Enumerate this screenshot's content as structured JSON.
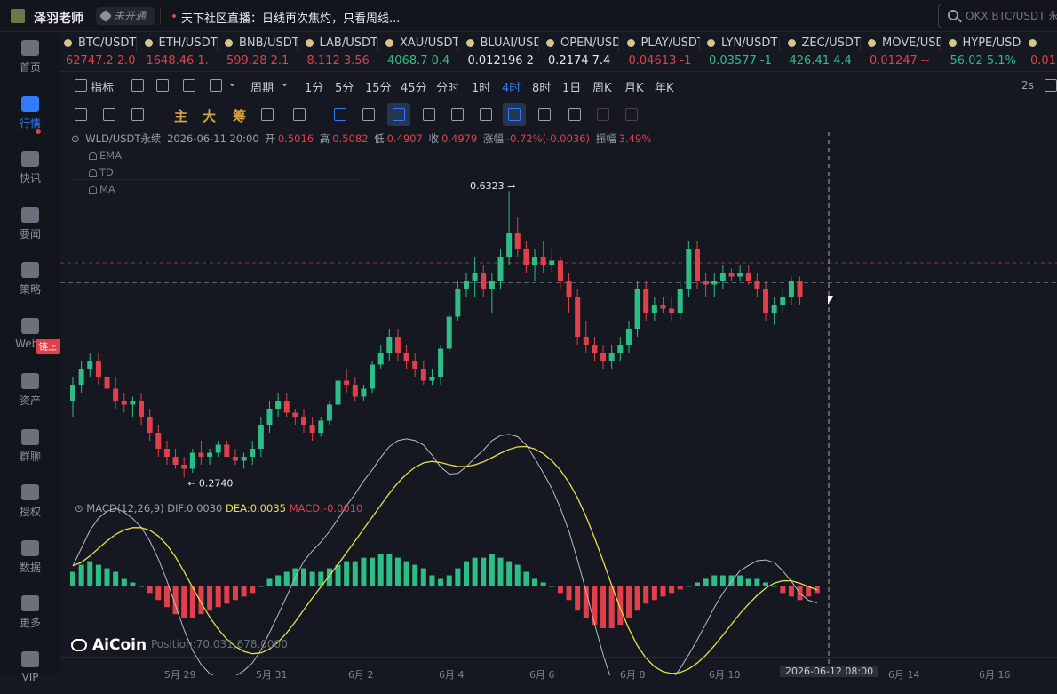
{
  "header": {
    "user_name": "泽羽老师",
    "status_badge": "未开通",
    "news": "天下社区直播：日线再次焦灼，只看周线...",
    "search_placeholder": "OKX BTC/USDT 永续"
  },
  "sidebar": {
    "items": [
      {
        "label": "首页",
        "icon": "home-icon"
      },
      {
        "label": "行情",
        "icon": "market-icon"
      },
      {
        "label": "快讯",
        "icon": "flash-news-icon"
      },
      {
        "label": "要闻",
        "icon": "news-icon"
      },
      {
        "label": "策略",
        "icon": "strategy-icon"
      },
      {
        "label": "Web3",
        "icon": "web3-icon"
      },
      {
        "label": "资产",
        "icon": "wallet-icon"
      },
      {
        "label": "群聊",
        "icon": "chat-icon"
      },
      {
        "label": "授权",
        "icon": "key-icon"
      },
      {
        "label": "数据",
        "icon": "data-icon"
      },
      {
        "label": "更多",
        "icon": "more-icon"
      },
      {
        "label": "VIP",
        "icon": "vip-icon"
      }
    ],
    "badge": "链上"
  },
  "ticker": [
    {
      "name": "BTC/USDT",
      "price": "62747.2",
      "change": "2.0",
      "dir": "dn"
    },
    {
      "name": "ETH/USDT",
      "price": "1648.46",
      "change": "1.",
      "dir": "dn"
    },
    {
      "name": "BNB/USDT",
      "price": "599.28",
      "change": "2.1",
      "dir": "dn"
    },
    {
      "name": "LAB/USDT",
      "price": "8.112",
      "change": "3.56",
      "dir": "dn"
    },
    {
      "name": "XAU/USDT",
      "price": "4068.7",
      "change": "0.4",
      "dir": "up"
    },
    {
      "name": "BLUAI/USDT",
      "price": "0.012196",
      "change": "2",
      "dir": "wh"
    },
    {
      "name": "OPEN/USDT",
      "price": "0.2174",
      "change": "7.4",
      "dir": "wh"
    },
    {
      "name": "PLAY/USDT",
      "price": "0.04613",
      "change": "-1",
      "dir": "dn"
    },
    {
      "name": "LYN/USDT",
      "price": "0.03577",
      "change": "-1",
      "dir": "up"
    },
    {
      "name": "ZEC/USDT",
      "price": "426.41",
      "change": "4.4",
      "dir": "up"
    },
    {
      "name": "MOVE/USDT",
      "price": "0.01247",
      "change": "--",
      "dir": "dn"
    },
    {
      "name": "HYPE/USDT",
      "price": "56.02",
      "change": "5.1%",
      "dir": "up"
    },
    {
      "name": "",
      "price": "0.01",
      "change": "",
      "dir": "dn"
    }
  ],
  "toolbar": {
    "indicator_label": "指标",
    "period_label": "周期",
    "periods": [
      "1分",
      "5分",
      "15分",
      "45分",
      "分时",
      "1时",
      "4时",
      "8时",
      "1日",
      "周K",
      "月K",
      "年K"
    ],
    "active_period": "4时",
    "refresh": "2s",
    "main": "主",
    "big": "大",
    "chips": "筹"
  },
  "chartinfo": {
    "symbol": "WLD/USDT永续",
    "time": "2026-06-11 20:00",
    "open_label": "开",
    "open": "0.5016",
    "high_label": "高",
    "high": "0.5082",
    "low_label": "低",
    "low": "0.4907",
    "close_label": "收",
    "close": "0.4979",
    "chg_label": "涨幅",
    "chg": "-0.72%(-0.0036)",
    "amp_label": "振幅",
    "amp": "3.49%"
  },
  "indicators": [
    "EMA",
    "TD",
    "MA"
  ],
  "macd": {
    "label": "MACD(12,26,9)",
    "dif": "DIF:0.0030",
    "dea": "DEA:0.0035",
    "macd": "MACD:-0.0010"
  },
  "footer": {
    "logo": "AiCoin",
    "position": "Position:70,031,678.0000",
    "x_labels": [
      "5月 29",
      "5月 31",
      "6月 2",
      "6月 4",
      "6月 6",
      "6月 8",
      "6月 10",
      "6月 14",
      "6月 16"
    ],
    "crosshair_time": "2026-06-12 08:00"
  },
  "chart_data": {
    "type": "candlestick",
    "symbol": "WLD/USDT永续",
    "interval": "4时",
    "high_mark": "0.6323",
    "low_mark": "0.2740",
    "ylim": [
      0.26,
      0.66
    ],
    "candles": [
      [
        0.37,
        0.4,
        0.35,
        0.39
      ],
      [
        0.39,
        0.42,
        0.38,
        0.41
      ],
      [
        0.41,
        0.43,
        0.4,
        0.42
      ],
      [
        0.42,
        0.43,
        0.39,
        0.4
      ],
      [
        0.4,
        0.41,
        0.38,
        0.385
      ],
      [
        0.385,
        0.4,
        0.36,
        0.37
      ],
      [
        0.37,
        0.38,
        0.355,
        0.365
      ],
      [
        0.365,
        0.375,
        0.35,
        0.37
      ],
      [
        0.37,
        0.38,
        0.34,
        0.35
      ],
      [
        0.35,
        0.36,
        0.32,
        0.33
      ],
      [
        0.33,
        0.34,
        0.3,
        0.31
      ],
      [
        0.31,
        0.32,
        0.29,
        0.3
      ],
      [
        0.3,
        0.31,
        0.285,
        0.29
      ],
      [
        0.29,
        0.3,
        0.274,
        0.285
      ],
      [
        0.285,
        0.31,
        0.28,
        0.305
      ],
      [
        0.305,
        0.32,
        0.29,
        0.3
      ],
      [
        0.3,
        0.31,
        0.29,
        0.305
      ],
      [
        0.305,
        0.32,
        0.3,
        0.315
      ],
      [
        0.315,
        0.32,
        0.3,
        0.3
      ],
      [
        0.3,
        0.31,
        0.29,
        0.295
      ],
      [
        0.295,
        0.305,
        0.285,
        0.3
      ],
      [
        0.3,
        0.32,
        0.29,
        0.31
      ],
      [
        0.31,
        0.35,
        0.3,
        0.34
      ],
      [
        0.34,
        0.37,
        0.33,
        0.36
      ],
      [
        0.36,
        0.38,
        0.35,
        0.37
      ],
      [
        0.37,
        0.38,
        0.35,
        0.355
      ],
      [
        0.355,
        0.36,
        0.34,
        0.35
      ],
      [
        0.35,
        0.36,
        0.33,
        0.34
      ],
      [
        0.34,
        0.35,
        0.32,
        0.33
      ],
      [
        0.33,
        0.35,
        0.325,
        0.345
      ],
      [
        0.345,
        0.37,
        0.34,
        0.365
      ],
      [
        0.365,
        0.4,
        0.36,
        0.395
      ],
      [
        0.395,
        0.41,
        0.38,
        0.39
      ],
      [
        0.39,
        0.4,
        0.37,
        0.375
      ],
      [
        0.375,
        0.39,
        0.37,
        0.385
      ],
      [
        0.385,
        0.42,
        0.38,
        0.415
      ],
      [
        0.415,
        0.44,
        0.41,
        0.43
      ],
      [
        0.43,
        0.46,
        0.42,
        0.45
      ],
      [
        0.45,
        0.46,
        0.42,
        0.43
      ],
      [
        0.43,
        0.44,
        0.41,
        0.42
      ],
      [
        0.42,
        0.43,
        0.4,
        0.41
      ],
      [
        0.41,
        0.42,
        0.39,
        0.395
      ],
      [
        0.395,
        0.41,
        0.39,
        0.4
      ],
      [
        0.4,
        0.44,
        0.39,
        0.435
      ],
      [
        0.435,
        0.48,
        0.43,
        0.475
      ],
      [
        0.475,
        0.52,
        0.47,
        0.51
      ],
      [
        0.51,
        0.53,
        0.5,
        0.52
      ],
      [
        0.52,
        0.55,
        0.5,
        0.53
      ],
      [
        0.53,
        0.54,
        0.5,
        0.51
      ],
      [
        0.51,
        0.53,
        0.48,
        0.52
      ],
      [
        0.52,
        0.56,
        0.51,
        0.55
      ],
      [
        0.55,
        0.632,
        0.54,
        0.58
      ],
      [
        0.58,
        0.6,
        0.55,
        0.56
      ],
      [
        0.56,
        0.57,
        0.53,
        0.54
      ],
      [
        0.54,
        0.56,
        0.52,
        0.55
      ],
      [
        0.55,
        0.57,
        0.53,
        0.54
      ],
      [
        0.54,
        0.56,
        0.53,
        0.545
      ],
      [
        0.545,
        0.55,
        0.51,
        0.52
      ],
      [
        0.52,
        0.53,
        0.48,
        0.5
      ],
      [
        0.5,
        0.51,
        0.44,
        0.45
      ],
      [
        0.45,
        0.47,
        0.43,
        0.44
      ],
      [
        0.44,
        0.45,
        0.42,
        0.43
      ],
      [
        0.43,
        0.44,
        0.41,
        0.42
      ],
      [
        0.42,
        0.44,
        0.41,
        0.43
      ],
      [
        0.43,
        0.45,
        0.42,
        0.44
      ],
      [
        0.44,
        0.47,
        0.43,
        0.46
      ],
      [
        0.46,
        0.52,
        0.45,
        0.51
      ],
      [
        0.51,
        0.52,
        0.47,
        0.48
      ],
      [
        0.48,
        0.5,
        0.47,
        0.49
      ],
      [
        0.49,
        0.5,
        0.48,
        0.485
      ],
      [
        0.485,
        0.5,
        0.47,
        0.48
      ],
      [
        0.48,
        0.52,
        0.47,
        0.51
      ],
      [
        0.51,
        0.57,
        0.5,
        0.56
      ],
      [
        0.56,
        0.57,
        0.51,
        0.52
      ],
      [
        0.52,
        0.53,
        0.5,
        0.515
      ],
      [
        0.515,
        0.53,
        0.5,
        0.52
      ],
      [
        0.52,
        0.54,
        0.51,
        0.53
      ],
      [
        0.53,
        0.535,
        0.52,
        0.525
      ],
      [
        0.525,
        0.54,
        0.52,
        0.53
      ],
      [
        0.53,
        0.54,
        0.515,
        0.52
      ],
      [
        0.52,
        0.53,
        0.5,
        0.51
      ],
      [
        0.51,
        0.52,
        0.47,
        0.48
      ],
      [
        0.48,
        0.5,
        0.465,
        0.49
      ],
      [
        0.49,
        0.51,
        0.48,
        0.5
      ],
      [
        0.5,
        0.525,
        0.49,
        0.52
      ],
      [
        0.52,
        0.525,
        0.49,
        0.5
      ]
    ],
    "macd": {
      "histogram": [
        0.004,
        0.006,
        0.007,
        0.006,
        0.005,
        0.004,
        0.002,
        0.001,
        0.0,
        -0.002,
        -0.004,
        -0.006,
        -0.008,
        -0.009,
        -0.009,
        -0.008,
        -0.007,
        -0.006,
        -0.005,
        -0.004,
        -0.003,
        -0.002,
        0.0,
        0.002,
        0.003,
        0.004,
        0.005,
        0.005,
        0.004,
        0.004,
        0.005,
        0.006,
        0.007,
        0.007,
        0.008,
        0.008,
        0.009,
        0.009,
        0.008,
        0.007,
        0.006,
        0.005,
        0.003,
        0.002,
        0.003,
        0.005,
        0.007,
        0.008,
        0.008,
        0.009,
        0.008,
        0.007,
        0.006,
        0.004,
        0.002,
        0.001,
        0.0,
        -0.002,
        -0.004,
        -0.007,
        -0.009,
        -0.011,
        -0.012,
        -0.012,
        -0.011,
        -0.009,
        -0.007,
        -0.005,
        -0.004,
        -0.003,
        -0.002,
        -0.001,
        0.0,
        0.001,
        0.002,
        0.003,
        0.003,
        0.003,
        0.003,
        0.002,
        0.002,
        0.001,
        0.0,
        -0.002,
        -0.003,
        -0.004,
        -0.003,
        -0.002
      ],
      "ylim": [
        -0.014,
        0.02
      ]
    }
  }
}
